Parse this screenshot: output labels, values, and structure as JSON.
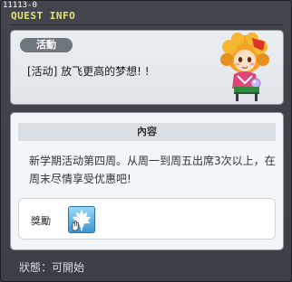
{
  "quest_id": "11113-0",
  "window": {
    "title": "QUEST INFO"
  },
  "quest": {
    "category_badge": "活動",
    "name": "[活动] 放飞更高的梦想! !",
    "npc_icon": "npc-girl-portrait"
  },
  "content": {
    "header": "內容",
    "description": "新学期活动第四周。从周一到周五出席3次以上，在周末尽情享受优惠吧!"
  },
  "reward": {
    "label": "獎勵",
    "item_icon": "maple-leaf-box-icon"
  },
  "status": {
    "text": "狀態：可開始"
  },
  "colors": {
    "title": "#e8e27a",
    "window_bg": "#3f4349",
    "panel_bg": "#eef2f5",
    "badge_bg": "#6d757d"
  }
}
